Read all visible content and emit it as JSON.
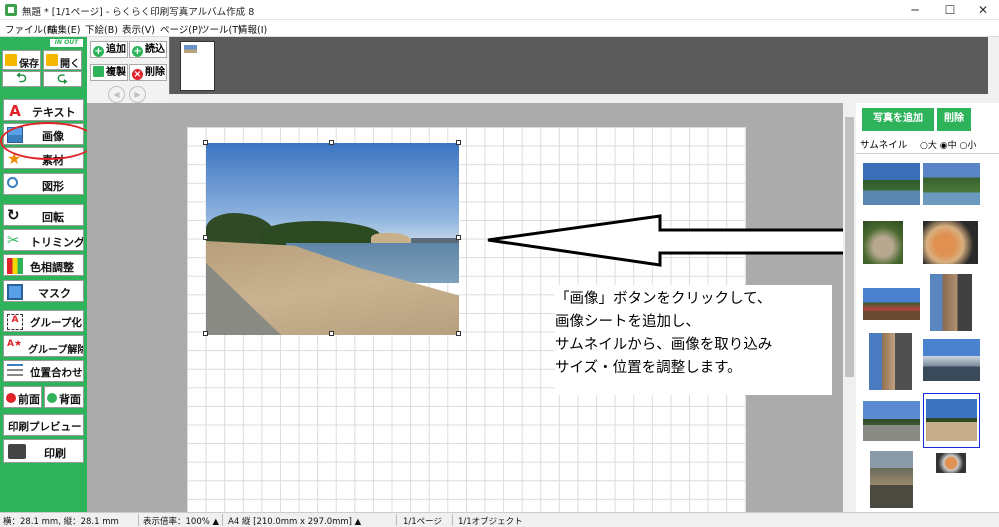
{
  "window": {
    "title": "無題 * [1/1ページ] - らくらく印刷写真アルバム作成 8",
    "minimize": "─",
    "maximize": "☐",
    "close": "✕"
  },
  "menu": [
    "ファイル(F)",
    "編集(E)",
    "下絵(B)",
    "表示(V)",
    "ページ(P)",
    "ツール(T)",
    "情報(I)"
  ],
  "left_panel": {
    "badge": "IN OUT",
    "save": "保存",
    "open": "開く",
    "undo": "⮌",
    "redo": "⮎",
    "text": "テキスト",
    "image": "画像",
    "material": "素材",
    "shape": "図形",
    "rotate": "回転",
    "trimming": "トリミング",
    "hue": "色相調整",
    "mask": "マスク",
    "group": "グループ化",
    "ungroup": "グループ解除",
    "align": "位置合わせ",
    "front": "前面",
    "back": "背面",
    "preview": "印刷プレビュー",
    "print": "印刷"
  },
  "page_tools": {
    "add": "追加",
    "load": "読込",
    "copy": "複製",
    "delete": "削除",
    "prev": "◀",
    "next": "▶"
  },
  "right_panel": {
    "add_photo": "写真を追加",
    "delete": "削除",
    "thumb_label": "サムネイル",
    "size_large": "大",
    "size_medium": "中",
    "size_small": "小",
    "selected_size": "中"
  },
  "callout": {
    "lines": [
      "「画像」ボタンをクリックして、",
      "画像シートを追加し、",
      "サムネイルから、画像を取り込み",
      "サイズ・位置を調整します。"
    ]
  },
  "status": {
    "position": "横：28.1 mm, 縦：28.1 mm",
    "zoom": "表示倍率：100% ▲",
    "paper": "A4 縦 [210.0mm x 297.0mm] ▲",
    "page": "1/1ページ",
    "objects": "1/1オブジェクト"
  },
  "colors": {
    "accent_green": "#2fb35a",
    "highlight_red": "#e0232b"
  }
}
